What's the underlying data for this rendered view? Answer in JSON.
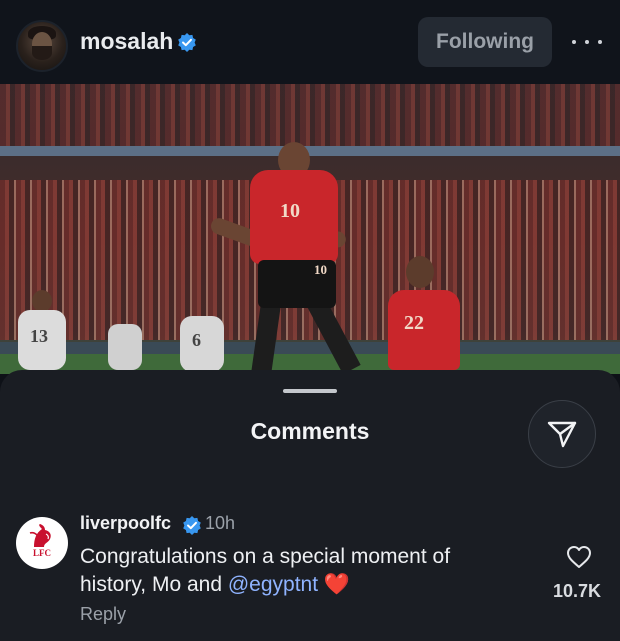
{
  "header": {
    "username": "mosalah",
    "follow_label": "Following",
    "avatar_icon": "profile-avatar",
    "more_icon": "more-horizontal-icon"
  },
  "post": {
    "image_icon": "post-photo",
    "jersey_numbers": [
      "10",
      "10",
      "22",
      "13",
      "6"
    ]
  },
  "comments_sheet": {
    "title": "Comments",
    "share_icon": "send-icon",
    "comments": [
      {
        "username": "liverpoolfc",
        "verified": true,
        "time": "10h",
        "text": "Congratulations on a special moment of history, Mo and",
        "mention": "@egyptnt",
        "emoji": "❤️",
        "reply_label": "Reply",
        "like_count": "10.7K",
        "avatar_text": "LFC"
      }
    ]
  },
  "colors": {
    "background": "#0e1117",
    "verified": "#3897f0",
    "mention": "#8fb3ff",
    "liverpool_red": "#c8102e"
  }
}
